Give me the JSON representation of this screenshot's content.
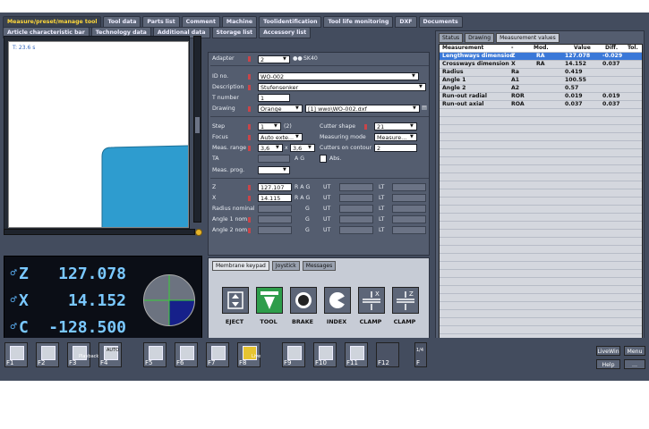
{
  "tabs_row1": [
    "Measure/preset/manage tool",
    "Tool data",
    "Parts list",
    "Comment",
    "Machine",
    "Toolidentification",
    "Tool life monitoring",
    "DXF",
    "Documents"
  ],
  "tabs_row2": [
    "Article characteristic bar",
    "Technology data",
    "Additional data",
    "Storage list",
    "Accessory list"
  ],
  "viewer": {
    "time": "T: 23.6 s"
  },
  "dro": {
    "z": {
      "axis": "Z",
      "value": "127.078"
    },
    "x": {
      "axis": "X",
      "value": "14.152"
    },
    "c": {
      "axis": "C",
      "value": "-128.500"
    }
  },
  "form": {
    "adapter_label": "Adapter",
    "adapter_value": "2",
    "adapter_suffix": "SK40",
    "id_label": "ID no.",
    "id_value": "WO-002",
    "desc_label": "Description",
    "desc_value": "Stufensenker",
    "tnum_label": "T number",
    "tnum_value": "1",
    "drawing_label": "Drawing",
    "drawing_color": "Orange",
    "drawing_file": "[1] wwo\\WO-002.dxf",
    "step_label": "Step",
    "step_value": "1",
    "step_total": "(2)",
    "cutter_label": "Cutter shape",
    "cutter_value": "21",
    "focus_label": "Focus",
    "focus_value": "Auto exte...",
    "mmode_label": "Measuring mode",
    "mmode_value": "Measure...",
    "range_label": "Meas. range",
    "range_a": "3,6",
    "range_x": "x",
    "range_b": "3,6",
    "coc_label": "Cutters on contour",
    "coc_value": "2",
    "ta_label": "TA",
    "abs_label": "Abs.",
    "prog_label": "Meas. prog.",
    "z_label": "Z",
    "z_value": "127.107",
    "z_flags": "R A G",
    "z_ut": "UT",
    "z_lt": "LT",
    "x_label": "X",
    "x_value": "14.115",
    "x_flags": "R A G",
    "x_ut": "UT",
    "x_lt": "LT",
    "rad_label": "Radius nominal",
    "rad_g": "G",
    "rad_ut": "UT",
    "rad_lt": "LT",
    "a1_label": "Angle 1 nom.",
    "a1_g": "G",
    "a1_ut": "UT",
    "a1_lt": "LT",
    "a2_label": "Angle 2 nom.",
    "a2_g": "G",
    "a2_ut": "UT",
    "a2_lt": "LT",
    "ag_label": "A G"
  },
  "keypad": {
    "tabs": [
      "Membrane keypad",
      "Joystick",
      "Messages"
    ],
    "buttons": [
      "EJECT",
      "TOOL",
      "BRAKE",
      "INDEX",
      "CLAMP",
      "CLAMP"
    ],
    "clamp_x": "X",
    "clamp_z": "Z"
  },
  "right": {
    "tabs": [
      "Status",
      "Drawing",
      "Measurement values"
    ],
    "headers": [
      "Measurement",
      "-",
      "Mod.",
      "Value",
      "Diff.",
      "Tol."
    ],
    "rows": [
      [
        "Lengthways dimension",
        "Z",
        "RA",
        "127.078",
        "-0.029",
        ""
      ],
      [
        "Crossways dimension",
        "X",
        "RA",
        "14.152",
        "0.037",
        ""
      ],
      [
        "Radius",
        "Ra",
        "",
        "0.419",
        "",
        ""
      ],
      [
        "Angle 1",
        "A1",
        "",
        "100.55",
        "",
        ""
      ],
      [
        "Angle 2",
        "A2",
        "",
        "0.57",
        "",
        ""
      ],
      [
        "Run-out radial",
        "ROR",
        "",
        "0.019",
        "0.019",
        ""
      ],
      [
        "Run-out axial",
        "ROA",
        "",
        "0.037",
        "0.037",
        ""
      ]
    ]
  },
  "fkeys": [
    "F1",
    "F2",
    "F3",
    "F4",
    "F5",
    "F6",
    "F7",
    "F8",
    "F9",
    "F10",
    "F11",
    "F12",
    "F"
  ],
  "fkey_sub": {
    "f3": "Playback",
    "f4": "AUTO",
    "f8": "Live",
    "f13": "1/4"
  },
  "right_buttons": {
    "livewin": "LiveWin",
    "menu": "Menu",
    "help": "Help",
    "more": "..."
  }
}
